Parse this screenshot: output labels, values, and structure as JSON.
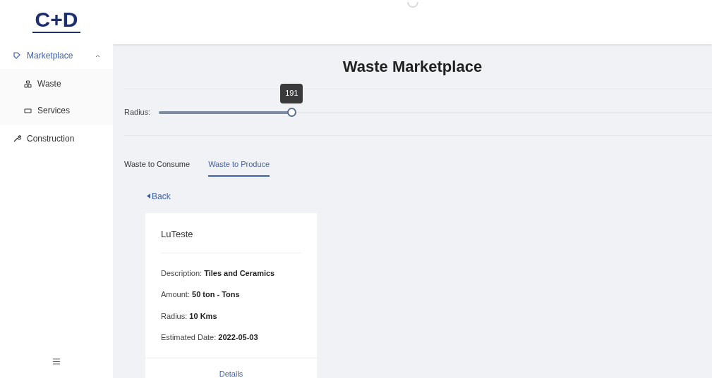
{
  "logo": "C+D",
  "sidebar": {
    "items": [
      {
        "label": "Marketplace",
        "expanded": true,
        "children": [
          {
            "label": "Waste"
          },
          {
            "label": "Services"
          }
        ]
      },
      {
        "label": "Construction"
      }
    ]
  },
  "title": "Waste Marketplace",
  "radius": {
    "label": "Radius:",
    "level": 0.24,
    "tooltip": "191"
  },
  "tabs": [
    {
      "label": "Waste to Consume",
      "selected": false
    },
    {
      "label": "Waste to Produce",
      "selected": true
    }
  ],
  "back": "Back",
  "card": {
    "title": "LuTeste",
    "fields": [
      {
        "label": "Description:",
        "value": "Tiles and Ceramics"
      },
      {
        "label": "Amount:",
        "value": "50 ton - Tons"
      },
      {
        "label": "Radius:",
        "value": "10 Kms"
      },
      {
        "label": "Estimated Date:",
        "value": "2022-05-03"
      }
    ],
    "action": "Details"
  }
}
